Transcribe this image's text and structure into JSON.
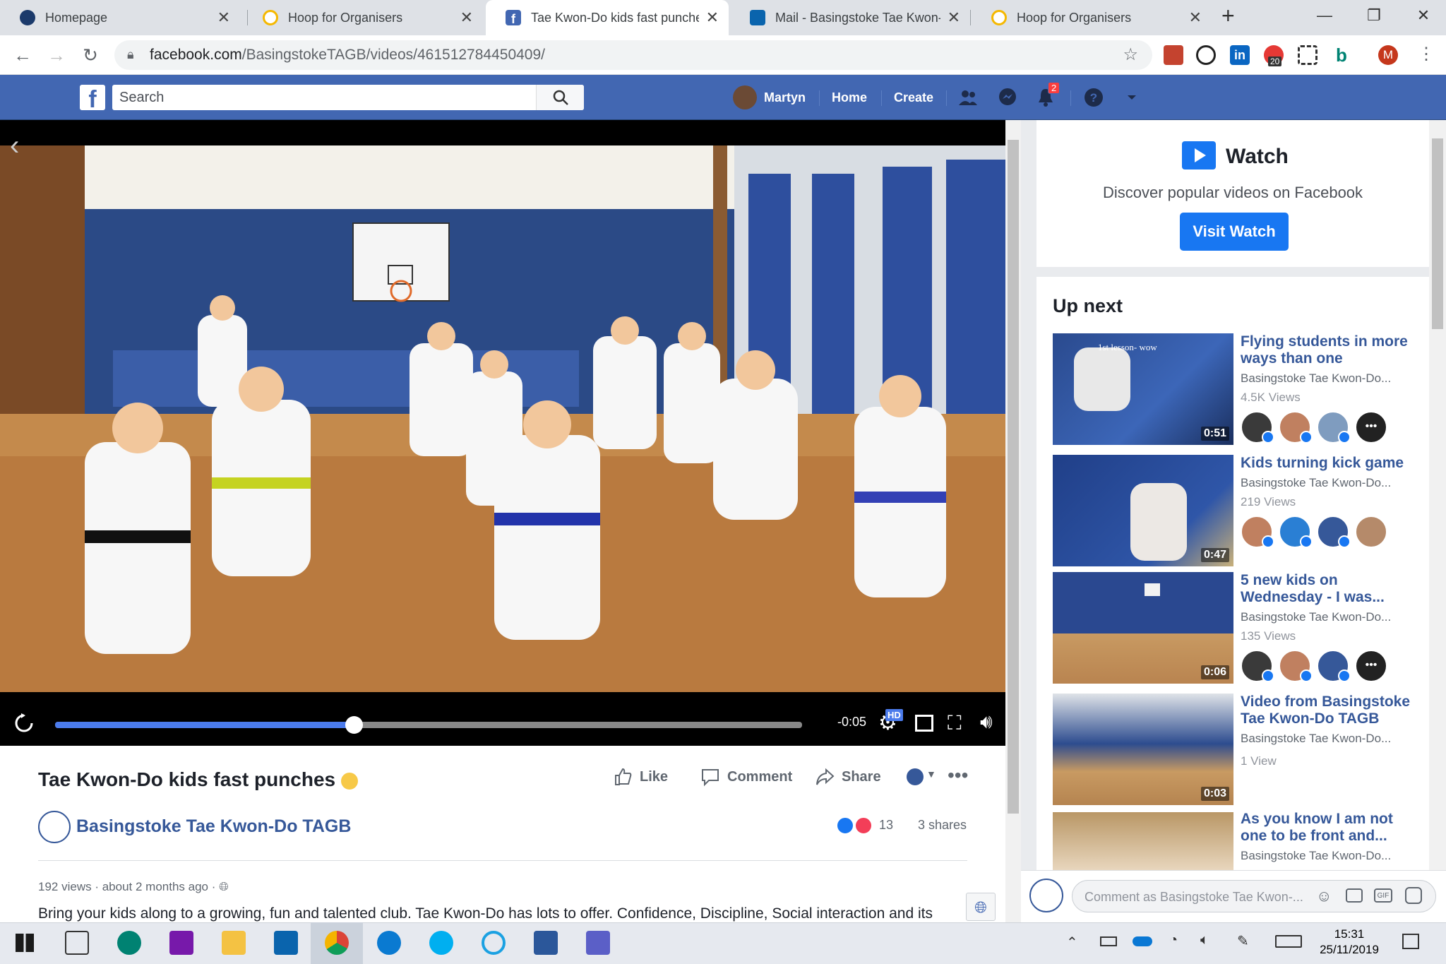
{
  "browser": {
    "tabs": [
      {
        "label": "Homepage",
        "active": false
      },
      {
        "label": "Hoop for Organisers",
        "active": false
      },
      {
        "label": "Tae Kwon-Do kids fast punches",
        "active": true
      },
      {
        "label": "Mail - Basingstoke Tae Kwon-D",
        "active": false
      },
      {
        "label": "Hoop for Organisers",
        "active": false
      }
    ],
    "url_host": "facebook.com",
    "url_path": "/BasingstokeTAGB/videos/461512784450409/",
    "badge_count": "20",
    "profile_letter": "M"
  },
  "fb": {
    "search_placeholder": "Search",
    "user": "Martyn",
    "nav_home": "Home",
    "nav_create": "Create",
    "notif_count": "2"
  },
  "video": {
    "time_remaining": "-0:05",
    "progress": 0.4,
    "hd_label": "HD"
  },
  "post": {
    "title": "Tae Kwon-Do kids fast punches",
    "like": "Like",
    "comment": "Comment",
    "share": "Share",
    "page_name": "Basingstoke Tae Kwon-Do TAGB",
    "reactions": "13",
    "shares": "3 shares",
    "views": "192 views",
    "time_ago": "about 2 months ago",
    "description": "Bring your kids along to a growing, fun and talented club. Tae Kwon-Do has lots to offer. Confidence, Discipline, Social interaction and its"
  },
  "sidebar": {
    "watch_title": "Watch",
    "watch_sub": "Discover popular videos on Facebook",
    "visit_watch": "Visit Watch",
    "up_next": "Up next",
    "videos": [
      {
        "title": "Flying students in more ways than one",
        "page": "Basingstoke Tae Kwon-Do...",
        "views": "4.5K Views",
        "duration": "0:51",
        "overlay": "1st lesson- wow"
      },
      {
        "title": "Kids turning kick game",
        "page": "Basingstoke Tae Kwon-Do...",
        "views": "219 Views",
        "duration": "0:47"
      },
      {
        "title": "5 new kids on Wednesday - I was...",
        "page": "Basingstoke Tae Kwon-Do...",
        "views": "135 Views",
        "duration": "0:06"
      },
      {
        "title": "Video from Basingstoke Tae Kwon-Do TAGB",
        "page": "Basingstoke Tae Kwon-Do...",
        "views": "1 View",
        "duration": "0:03"
      },
      {
        "title": "As you know I am not one to be front and...",
        "page": "Basingstoke Tae Kwon-Do..."
      }
    ],
    "comment_placeholder": "Comment as Basingstoke Tae Kwon-..."
  },
  "taskbar": {
    "time": "15:31",
    "date": "25/11/2019"
  },
  "colors": {
    "fb_blue": "#4267b2",
    "link_blue": "#365899",
    "button_blue": "#1877f2"
  }
}
